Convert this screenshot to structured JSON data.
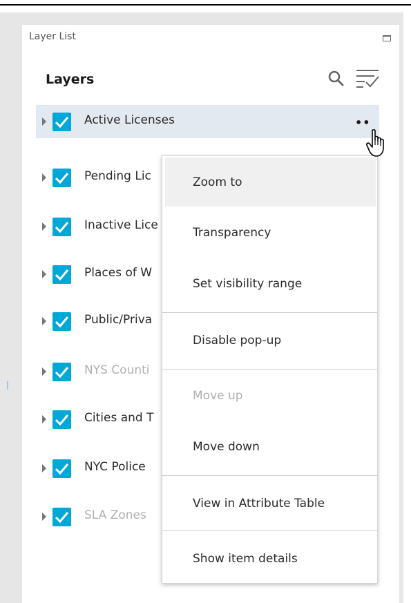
{
  "panel": {
    "title": "Layer List",
    "heading": "Layers"
  },
  "icons": {
    "maximize": "maximize-icon",
    "search": "search-icon",
    "filter": "filter-list-icon",
    "options": "ellipsis-icon",
    "cursor": "hand-pointer-icon",
    "expand": "caret-right-icon",
    "check": "checkmark-icon"
  },
  "colors": {
    "checkbox": "#00a8d8",
    "selected_row": "#e3e9f0",
    "menu_hover": "#f0f0f0",
    "disabled_text": "#b0b0b0"
  },
  "layers": [
    {
      "label": "Active Licenses",
      "checked": true,
      "dim": false,
      "selected": true
    },
    {
      "label": "Pending Lic",
      "checked": true,
      "dim": false,
      "selected": false
    },
    {
      "label": "Inactive Lice",
      "checked": true,
      "dim": false,
      "selected": false
    },
    {
      "label": "Places of W",
      "checked": true,
      "dim": false,
      "selected": false
    },
    {
      "label": "Public/Priva",
      "checked": true,
      "dim": false,
      "selected": false
    },
    {
      "label": "NYS Counti",
      "checked": true,
      "dim": true,
      "selected": false
    },
    {
      "label": "Cities and T",
      "checked": true,
      "dim": false,
      "selected": false
    },
    {
      "label": "NYC Police",
      "checked": true,
      "dim": false,
      "selected": false
    },
    {
      "label": "SLA Zones",
      "checked": true,
      "dim": true,
      "selected": false
    }
  ],
  "options_glyph": "••",
  "menu": {
    "items": [
      {
        "label": "Zoom to",
        "disabled": false,
        "hover": true
      },
      {
        "label": "Transparency",
        "disabled": false,
        "hover": false
      },
      {
        "label": "Set visibility range",
        "disabled": false,
        "hover": false
      },
      {
        "label": "Disable pop-up",
        "disabled": false,
        "hover": false
      },
      {
        "label": "Move up",
        "disabled": true,
        "hover": false
      },
      {
        "label": "Move down",
        "disabled": false,
        "hover": false
      },
      {
        "label": "View in Attribute Table",
        "disabled": false,
        "hover": false
      },
      {
        "label": "Show item details",
        "disabled": false,
        "hover": false
      }
    ]
  }
}
